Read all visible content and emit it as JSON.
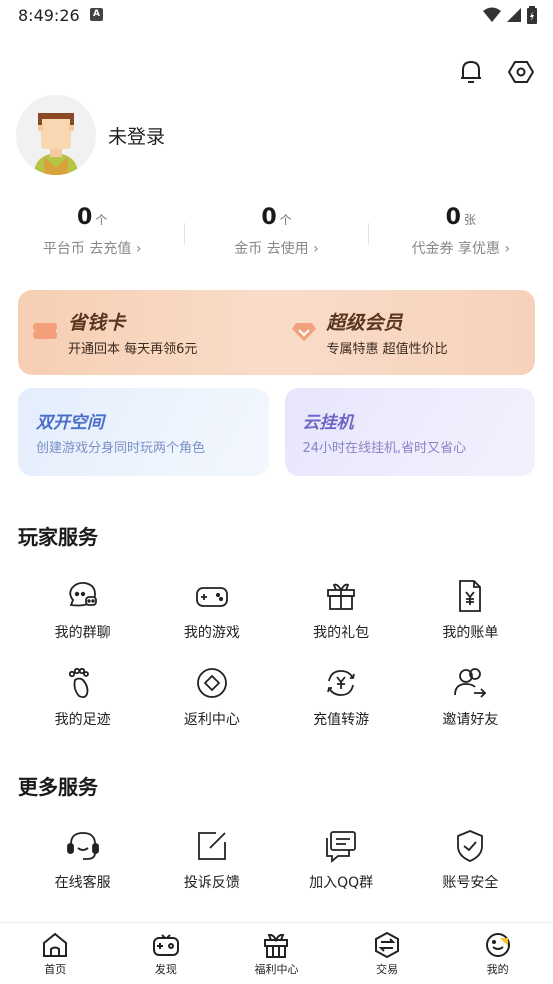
{
  "status": {
    "time": "8:49:26",
    "a_badge": "A"
  },
  "profile": {
    "login_text": "未登录"
  },
  "stats": [
    {
      "value": "0",
      "unit": "个",
      "label": "平台币 去充值"
    },
    {
      "value": "0",
      "unit": "个",
      "label": "金币 去使用"
    },
    {
      "value": "0",
      "unit": "张",
      "label": "代金券 享优惠"
    }
  ],
  "member_card": {
    "left": {
      "title": "省钱卡",
      "subtitle": "开通回本 每天再领6元",
      "icon_char": "¥"
    },
    "right": {
      "title": "超级会员",
      "subtitle": "专属特惠 超值性价比"
    }
  },
  "features": [
    {
      "title": "双开空间",
      "subtitle": "创建游戏分身同时玩两个角色"
    },
    {
      "title": "云挂机",
      "subtitle": "24小时在线挂机,省时又省心"
    }
  ],
  "player_services": {
    "title": "玩家服务",
    "items": [
      {
        "label": "我的群聊",
        "icon": "group-chat-icon"
      },
      {
        "label": "我的游戏",
        "icon": "gamepad-icon"
      },
      {
        "label": "我的礼包",
        "icon": "gift-icon"
      },
      {
        "label": "我的账单",
        "icon": "bill-icon"
      },
      {
        "label": "我的足迹",
        "icon": "footprint-icon"
      },
      {
        "label": "返利中心",
        "icon": "rebate-icon"
      },
      {
        "label": "充值转游",
        "icon": "recharge-transfer-icon"
      },
      {
        "label": "邀请好友",
        "icon": "invite-friend-icon"
      }
    ]
  },
  "more_services": {
    "title": "更多服务",
    "items": [
      {
        "label": "在线客服",
        "icon": "headset-icon"
      },
      {
        "label": "投诉反馈",
        "icon": "feedback-icon"
      },
      {
        "label": "加入QQ群",
        "icon": "qq-group-icon"
      },
      {
        "label": "账号安全",
        "icon": "shield-icon"
      }
    ]
  },
  "bottom_nav": [
    {
      "label": "首页",
      "icon": "home-icon"
    },
    {
      "label": "发现",
      "icon": "discover-icon"
    },
    {
      "label": "福利中心",
      "icon": "welfare-icon"
    },
    {
      "label": "交易",
      "icon": "trade-icon"
    },
    {
      "label": "我的",
      "icon": "mine-icon"
    }
  ],
  "colors": {
    "member_title": "#5a3520",
    "feature_blue": "#4a6fc8",
    "feature_purple": "#6f66c6",
    "member_icon": "#f08a5d"
  }
}
